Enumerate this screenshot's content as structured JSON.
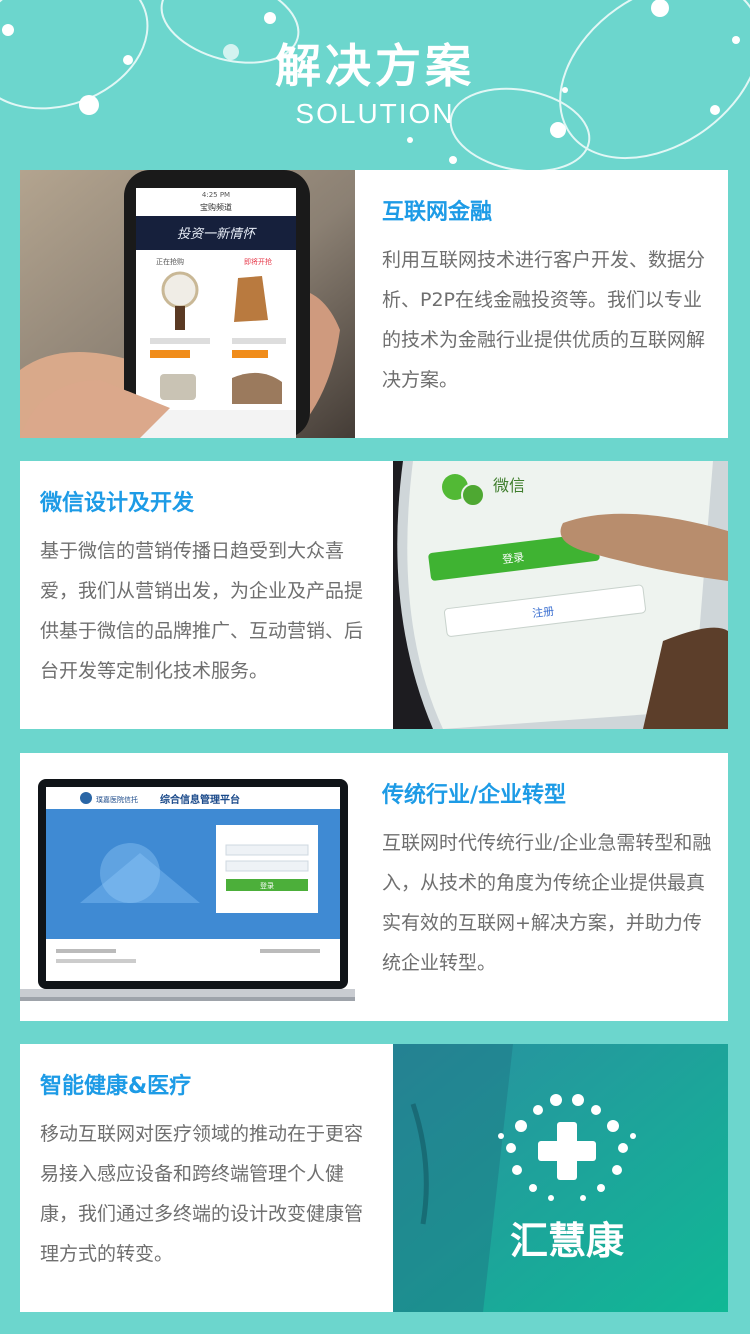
{
  "header": {
    "title": "解决方案",
    "subtitle": "SOLUTION"
  },
  "cards": [
    {
      "title": "互联网金融",
      "desc": "利用互联网技术进行客户开发、数据分析、P2P在线金融投资等。我们以专业的技术为金融行业提供优质的互联网解决方案。",
      "screen": {
        "status": "4:25 PM",
        "header": "宝购频道",
        "banner": "投资一新情怀",
        "tab1": "正在抢购",
        "tab2": "即将开抢"
      }
    },
    {
      "title": "微信设计及开发",
      "desc": "基于微信的营销传播日趋受到大众喜爱，我们从营销出发，为企业及产品提供基于微信的品牌推广、互动营销、后台开发等定制化技术服务。",
      "screen": {
        "app": "微信",
        "login": "登录",
        "register": "注册"
      }
    },
    {
      "title": "传统行业/企业转型",
      "desc": "互联网时代传统行业/企业急需转型和融入，从技术的角度为传统企业提供最真实有效的互联网+解决方案，并助力传统企业转型。",
      "screen": {
        "platform": "综合信息管理平台",
        "brand": "璞嘉医院信托",
        "login": "登录"
      }
    },
    {
      "title": "智能健康&医疗",
      "desc": "移动互联网对医疗领域的推动在于更容易接入感应设备和跨终端管理个人健康，我们通过多终端的设计改变健康管理方式的转变。",
      "logo": "汇慧康"
    }
  ]
}
